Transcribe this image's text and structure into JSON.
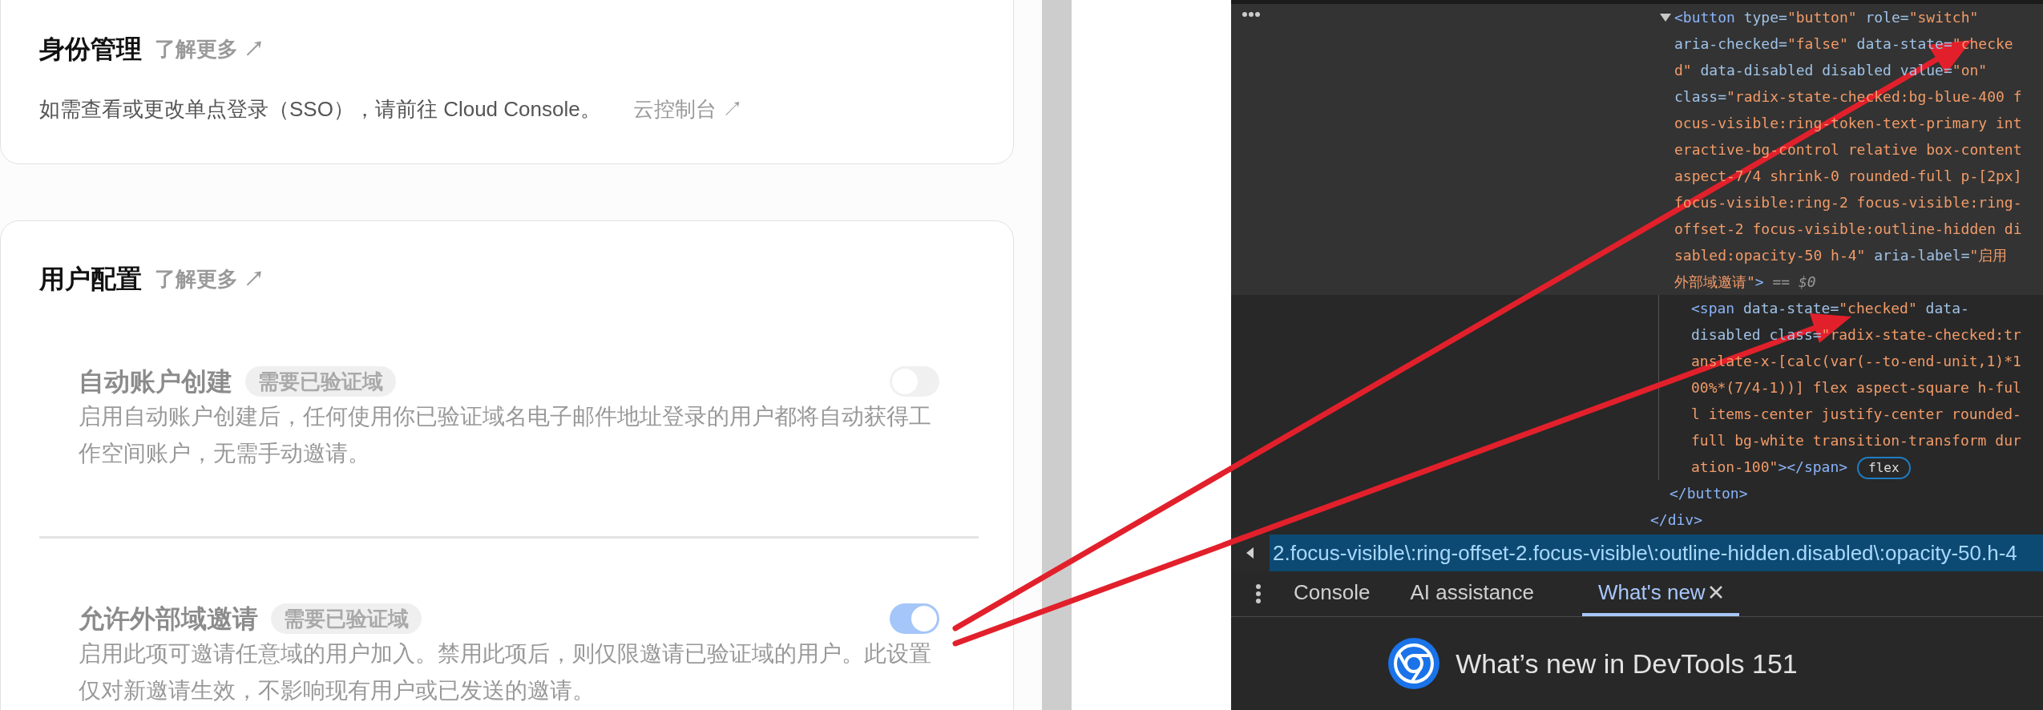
{
  "identity_card": {
    "title": "身份管理",
    "learn_more": "了解更多 ↗",
    "description": "如需查看或更改单点登录（SSO），请前往 Cloud Console。",
    "console_link": "云控制台 ↗"
  },
  "user_config_card": {
    "title": "用户配置",
    "learn_more": "了解更多 ↗",
    "settings": [
      {
        "title": "自动账户创建",
        "badge": "需要已验证域",
        "description": "启用自动账户创建后，任何使用你已验证域名电子邮件地址登录的用户都将自动获得工作空间账户，无需手动邀请。",
        "on": false,
        "disabled": true
      },
      {
        "title": "允许外部域邀请",
        "badge": "需要已验证域",
        "description": "启用此项可邀请任意域的用户加入。禁用此项后，则仅限邀请已验证域的用户。此设置仅对新邀请生效，不影响现有用户或已发送的邀请。",
        "on": true,
        "disabled": true
      }
    ]
  },
  "devtools": {
    "dom_tree": {
      "children": [
        {
          "selected": true,
          "expanded": true,
          "lines": [
            [
              {
                "kind": "tag",
                "text": "<button"
              },
              {
                "kind": "attr",
                "text": " type="
              },
              {
                "kind": "value",
                "text": "\"button\""
              },
              {
                "kind": "attr",
                "text": " role="
              },
              {
                "kind": "value",
                "text": "\"switch\""
              }
            ],
            [
              {
                "kind": "attr",
                "text": "aria-checked="
              },
              {
                "kind": "value",
                "text": "\"false\""
              },
              {
                "kind": "attr",
                "text": " data-state="
              },
              {
                "kind": "value",
                "text": "\"checke"
              }
            ],
            [
              {
                "kind": "value",
                "text": "d\""
              },
              {
                "kind": "attr",
                "text": " data-disabled disabled value="
              },
              {
                "kind": "value",
                "text": "\"on\""
              }
            ],
            [
              {
                "kind": "attr",
                "text": "class="
              },
              {
                "kind": "value",
                "text": "\"radix-state-checked:bg-blue-400 f"
              }
            ],
            [
              {
                "kind": "value",
                "text": "ocus-visible:ring-token-text-primary int"
              }
            ],
            [
              {
                "kind": "value",
                "text": "eractive-bg-control relative box-content"
              }
            ],
            [
              {
                "kind": "value",
                "text": "aspect-7/4 shrink-0 rounded-full p-[2px]"
              }
            ],
            [
              {
                "kind": "value",
                "text": "focus-visible:ring-2 focus-visible:ring-"
              }
            ],
            [
              {
                "kind": "value",
                "text": "offset-2 focus-visible:outline-hidden di"
              }
            ],
            [
              {
                "kind": "value",
                "text": "sabled:opacity-50 h-4\""
              },
              {
                "kind": "attr",
                "text": " aria-label="
              },
              {
                "kind": "value",
                "text": "\"启用"
              }
            ],
            [
              {
                "kind": "value",
                "text": "外部域邀请\""
              },
              {
                "kind": "tag",
                "text": ">"
              },
              {
                "kind": "comment",
                "text": " == $0"
              }
            ]
          ],
          "children": [
            {
              "selected": false,
              "expanded": false,
              "badge": "flex",
              "lines": [
                [
                  {
                    "kind": "tag",
                    "text": "<span"
                  },
                  {
                    "kind": "attr",
                    "text": " data-state="
                  },
                  {
                    "kind": "value",
                    "text": "\"checked\""
                  },
                  {
                    "kind": "attr",
                    "text": " data-"
                  }
                ],
                [
                  {
                    "kind": "attr",
                    "text": "disabled class="
                  },
                  {
                    "kind": "value",
                    "text": "\"radix-state-checked:tr"
                  }
                ],
                [
                  {
                    "kind": "value",
                    "text": "anslate-x-[calc(var(--to-end-unit,1)*1"
                  }
                ],
                [
                  {
                    "kind": "value",
                    "text": "00%*(7/4-1))] flex aspect-square h-ful"
                  }
                ],
                [
                  {
                    "kind": "value",
                    "text": "l items-center justify-center rounded-"
                  }
                ],
                [
                  {
                    "kind": "value",
                    "text": "full bg-white transition-transform dur"
                  }
                ],
                [
                  {
                    "kind": "value",
                    "text": "ation-100\""
                  },
                  {
                    "kind": "tag",
                    "text": "></span>"
                  }
                ]
              ]
            }
          ],
          "closing": [
            {
              "kind": "tag",
              "text": "</button>"
            }
          ]
        }
      ],
      "closing": [
        {
          "kind": "tag",
          "text": "</div>"
        }
      ]
    },
    "breadcrumb": "2.focus-visible\\:ring-offset-2.focus-visible\\:outline-hidden.disabled\\:opacity-50.h-4",
    "drawer_tabs": [
      {
        "label": "Console",
        "selected": false,
        "closable": false
      },
      {
        "label": "AI assistance",
        "selected": false,
        "closable": false
      },
      {
        "label": "What's new",
        "selected": true,
        "closable": true
      }
    ],
    "whats_new_title": "What’s new in DevTools 151"
  }
}
